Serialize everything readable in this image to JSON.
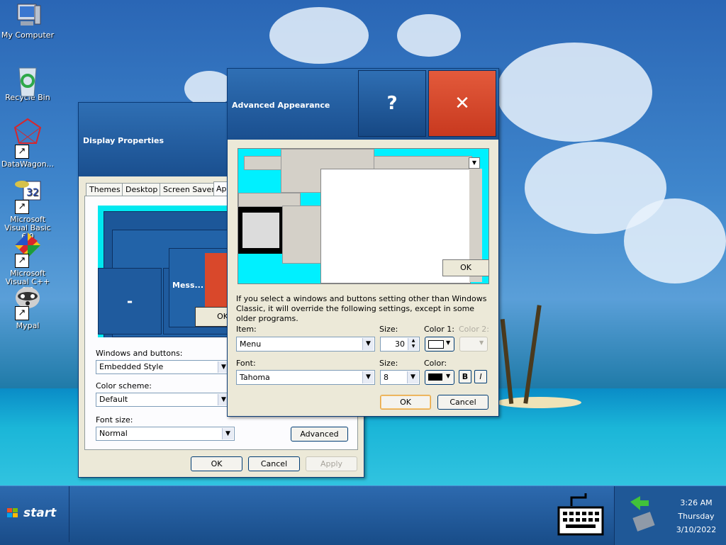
{
  "desktop": {
    "icons": [
      {
        "label": "My Computer",
        "icon": "computer-icon"
      },
      {
        "label": "Recycle Bin",
        "icon": "recycle-bin-icon"
      },
      {
        "label": "DataWagon...",
        "icon": "datawagon-icon"
      },
      {
        "label": "Microsoft Visual Basic 6.0",
        "icon": "visual-basic-icon"
      },
      {
        "label": "Microsoft Visual C++ 6.0",
        "icon": "visual-cpp-icon"
      },
      {
        "label": "Mypal",
        "icon": "mypal-icon"
      }
    ]
  },
  "display_properties": {
    "title": "Display Properties",
    "tabs": [
      "Themes",
      "Desktop",
      "Screen Saver",
      "Ap"
    ],
    "preview": {
      "button_minimize": "-",
      "message_title": "Mess...",
      "ok": "OK"
    },
    "windows_and_buttons_label": "Windows and buttons:",
    "windows_and_buttons_value": "Embedded Style",
    "color_scheme_label": "Color scheme:",
    "color_scheme_value": "Default",
    "font_size_label": "Font size:",
    "font_size_value": "Normal",
    "advanced_button": "Advanced",
    "ok": "OK",
    "cancel": "Cancel",
    "apply": "Apply"
  },
  "advanced_appearance": {
    "title": "Advanced Appearance",
    "help_button": "?",
    "close_button": "✕",
    "preview_ok": "OK",
    "info_text": "If you select a windows and buttons setting other than Windows Classic, it will override the following settings, except in some older programs.",
    "item_label": "Item:",
    "item_value": "Menu",
    "size_label": "Size:",
    "size_value": "30",
    "color1_label": "Color 1:",
    "color2_label": "Color 2:",
    "font_label": "Font:",
    "font_value": "Tahoma",
    "font_size_label": "Size:",
    "font_size_value": "8",
    "font_color_label": "Color:",
    "bold_button": "B",
    "italic_button": "I",
    "ok": "OK",
    "cancel": "Cancel"
  },
  "taskbar": {
    "start_label": "start",
    "clock": {
      "time": "3:26 AM",
      "day": "Thursday",
      "date": "3/10/2022"
    }
  },
  "colors": {
    "accent": "#1a4f8f",
    "close": "#d9482b",
    "preview_cyan": "#00f0ff"
  }
}
